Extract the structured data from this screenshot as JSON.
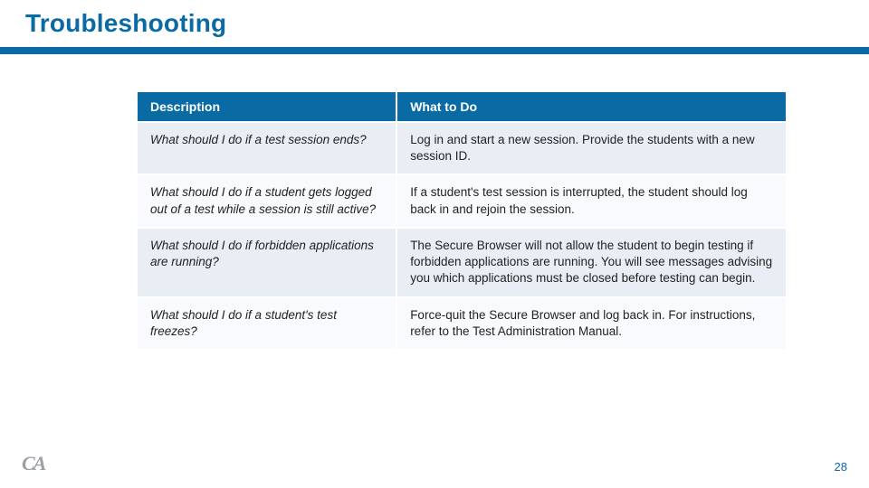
{
  "header": {
    "title": "Troubleshooting"
  },
  "table": {
    "columns": {
      "description": "Description",
      "what_to_do": "What to Do"
    },
    "rows": [
      {
        "description": "What should I do if a test session ends?",
        "what_to_do": "Log in and start a new session. Provide the students with a new session ID."
      },
      {
        "description": "What should I do if a student gets logged out of a test while a session is still active?",
        "what_to_do": "If a student's test session is interrupted, the student should log back in and rejoin the session."
      },
      {
        "description": "What should I do if forbidden applications are running?",
        "what_to_do": "The Secure Browser will not allow the student to begin testing if forbidden applications are running. You will see messages advising you which applications must be closed before testing can begin."
      },
      {
        "description": "What should I do if a student's test freezes?",
        "what_to_do": "Force-quit the Secure Browser and log back in. For instructions, refer to the Test Administration Manual."
      }
    ]
  },
  "footer": {
    "logo_text": "CA",
    "page_number": "28"
  }
}
